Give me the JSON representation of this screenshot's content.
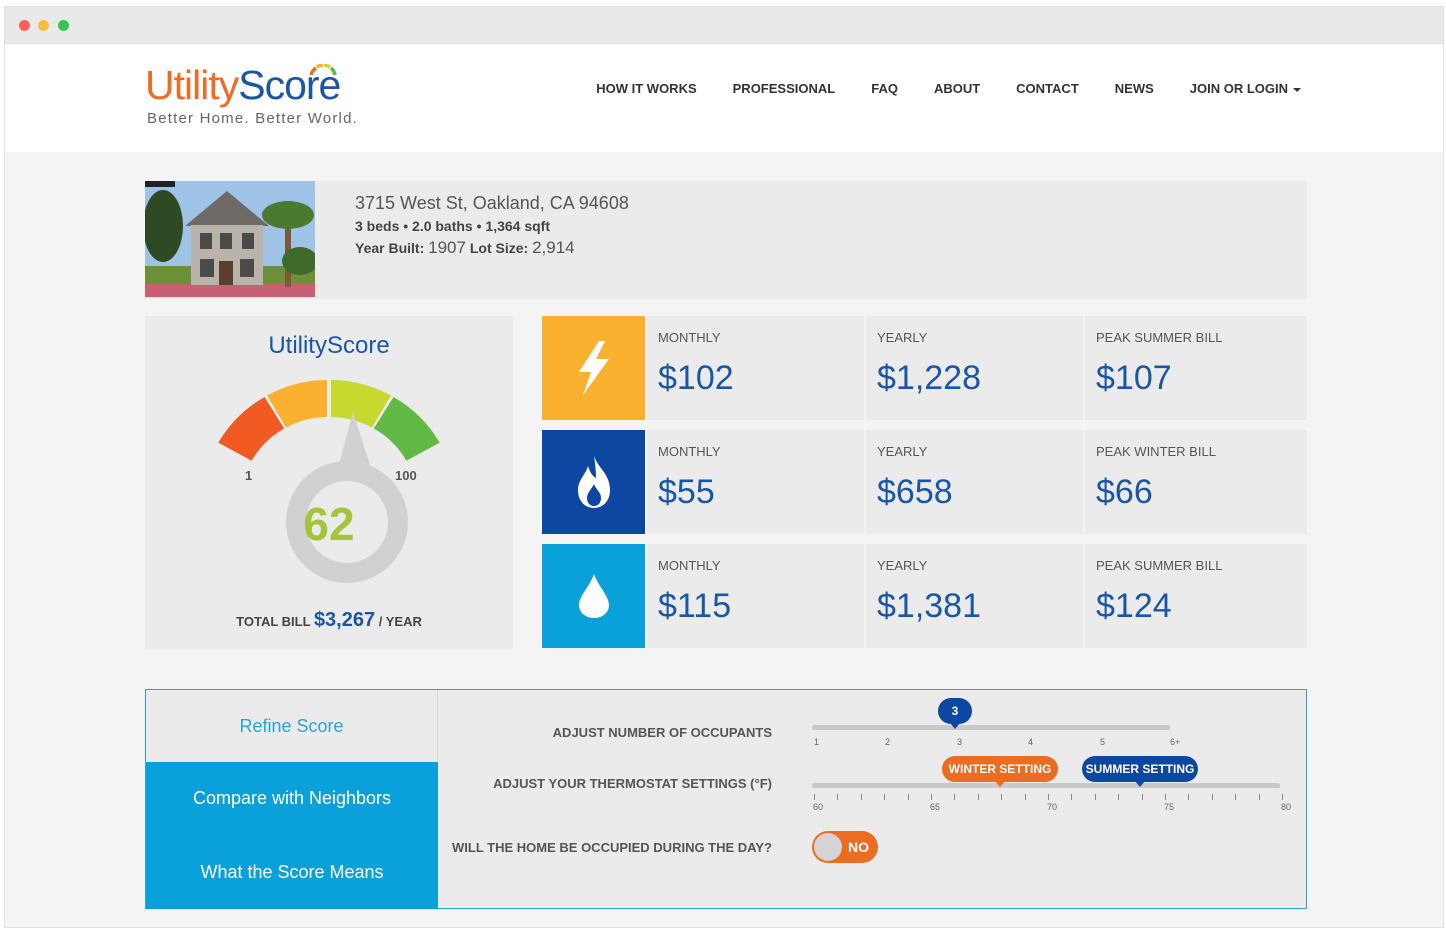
{
  "brand": {
    "name_part1": "Utility",
    "name_part2": "Score",
    "tagline": "Better Home. Better World."
  },
  "nav": {
    "items": [
      "HOW IT WORKS",
      "PROFESSIONAL",
      "FAQ",
      "ABOUT",
      "CONTACT",
      "NEWS"
    ],
    "join": "JOIN OR LOGIN"
  },
  "property": {
    "address": "3715 West St, Oakland, CA 94608",
    "specs": "3 beds • 2.0 baths • 1,364 sqft",
    "year_built_label": "Year Built:",
    "year_built": "1907",
    "lot_size_label": "Lot Size:",
    "lot_size": "2,914"
  },
  "score": {
    "title": "UtilityScore",
    "value": "62",
    "min_label": "1",
    "max_label": "100",
    "total_label": "TOTAL BILL",
    "total_amount": "$3,267",
    "total_suffix": "/ YEAR"
  },
  "utilities": {
    "electric": {
      "icon": "lightning-icon",
      "color": "#fbb130",
      "monthly_label": "MONTHLY",
      "monthly": "$102",
      "yearly_label": "YEARLY",
      "yearly": "$1,228",
      "peak_label": "PEAK SUMMER BILL",
      "peak": "$107"
    },
    "gas": {
      "icon": "flame-icon",
      "color": "#0d47a1",
      "monthly_label": "MONTHLY",
      "monthly": "$55",
      "yearly_label": "YEARLY",
      "yearly": "$658",
      "peak_label": "PEAK WINTER BILL",
      "peak": "$66"
    },
    "water": {
      "icon": "water-drop-icon",
      "color": "#0aa0da",
      "monthly_label": "MONTHLY",
      "monthly": "$115",
      "yearly_label": "YEARLY",
      "yearly": "$1,381",
      "peak_label": "PEAK SUMMER BILL",
      "peak": "$124"
    }
  },
  "refine": {
    "tabs": [
      "Refine Score",
      "Compare with Neighbors",
      "What the Score Means"
    ],
    "occupants_label": "ADJUST NUMBER OF OCCUPANTS",
    "occupants_value": "3",
    "occupants_ticks": [
      "1",
      "2",
      "3",
      "4",
      "5",
      "6+"
    ],
    "thermostat_label": "ADJUST YOUR THERMOSTAT SETTINGS (°F)",
    "winter_label": "WINTER SETTING",
    "summer_label": "SUMMER SETTING",
    "thermo_ticks": [
      "60",
      "65",
      "70",
      "75",
      "80"
    ],
    "occupied_label": "WILL THE HOME BE OCCUPIED DURING THE DAY?",
    "occupied_value": "NO"
  },
  "colors": {
    "brand_orange": "#ee6b22",
    "brand_blue": "#1a56a6",
    "accent_cyan": "#0aa0da",
    "score_green": "#a3c43d"
  }
}
